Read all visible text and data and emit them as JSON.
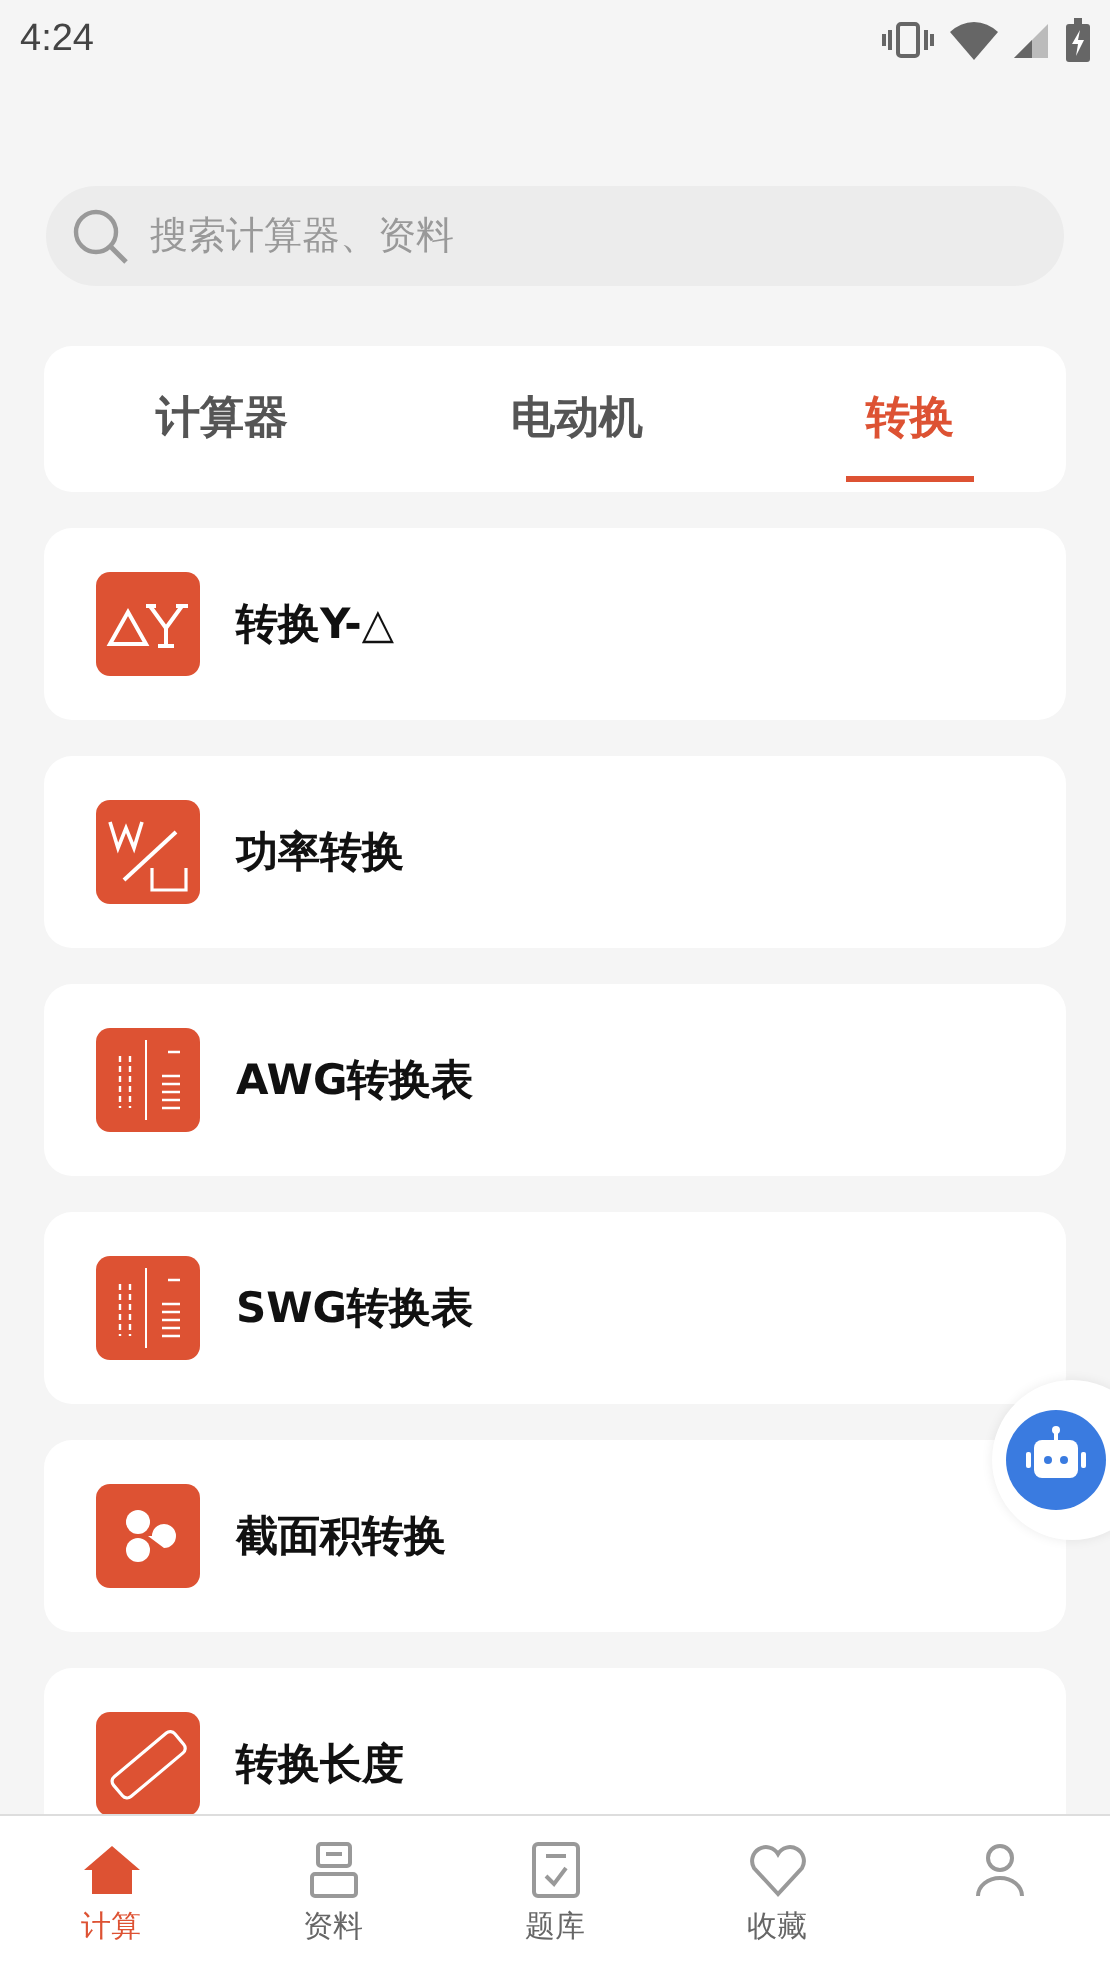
{
  "status_bar": {
    "time": "4:24"
  },
  "search": {
    "placeholder": "搜索计算器、资料"
  },
  "tabs": [
    {
      "label": "计算器",
      "selected": false
    },
    {
      "label": "电动机",
      "selected": false
    },
    {
      "label": "转换",
      "selected": true
    }
  ],
  "items": [
    {
      "title": "转换Y-△"
    },
    {
      "title": "功率转换"
    },
    {
      "title": "AWG转换表"
    },
    {
      "title": "SWG转换表"
    },
    {
      "title": "截面积转换"
    },
    {
      "title": "转换长度"
    }
  ],
  "bottom_nav": [
    {
      "label": "计算",
      "selected": true
    },
    {
      "label": "资料",
      "selected": false
    },
    {
      "label": "题库",
      "selected": false
    },
    {
      "label": "收藏",
      "selected": false
    },
    {
      "selected": false
    }
  ]
}
